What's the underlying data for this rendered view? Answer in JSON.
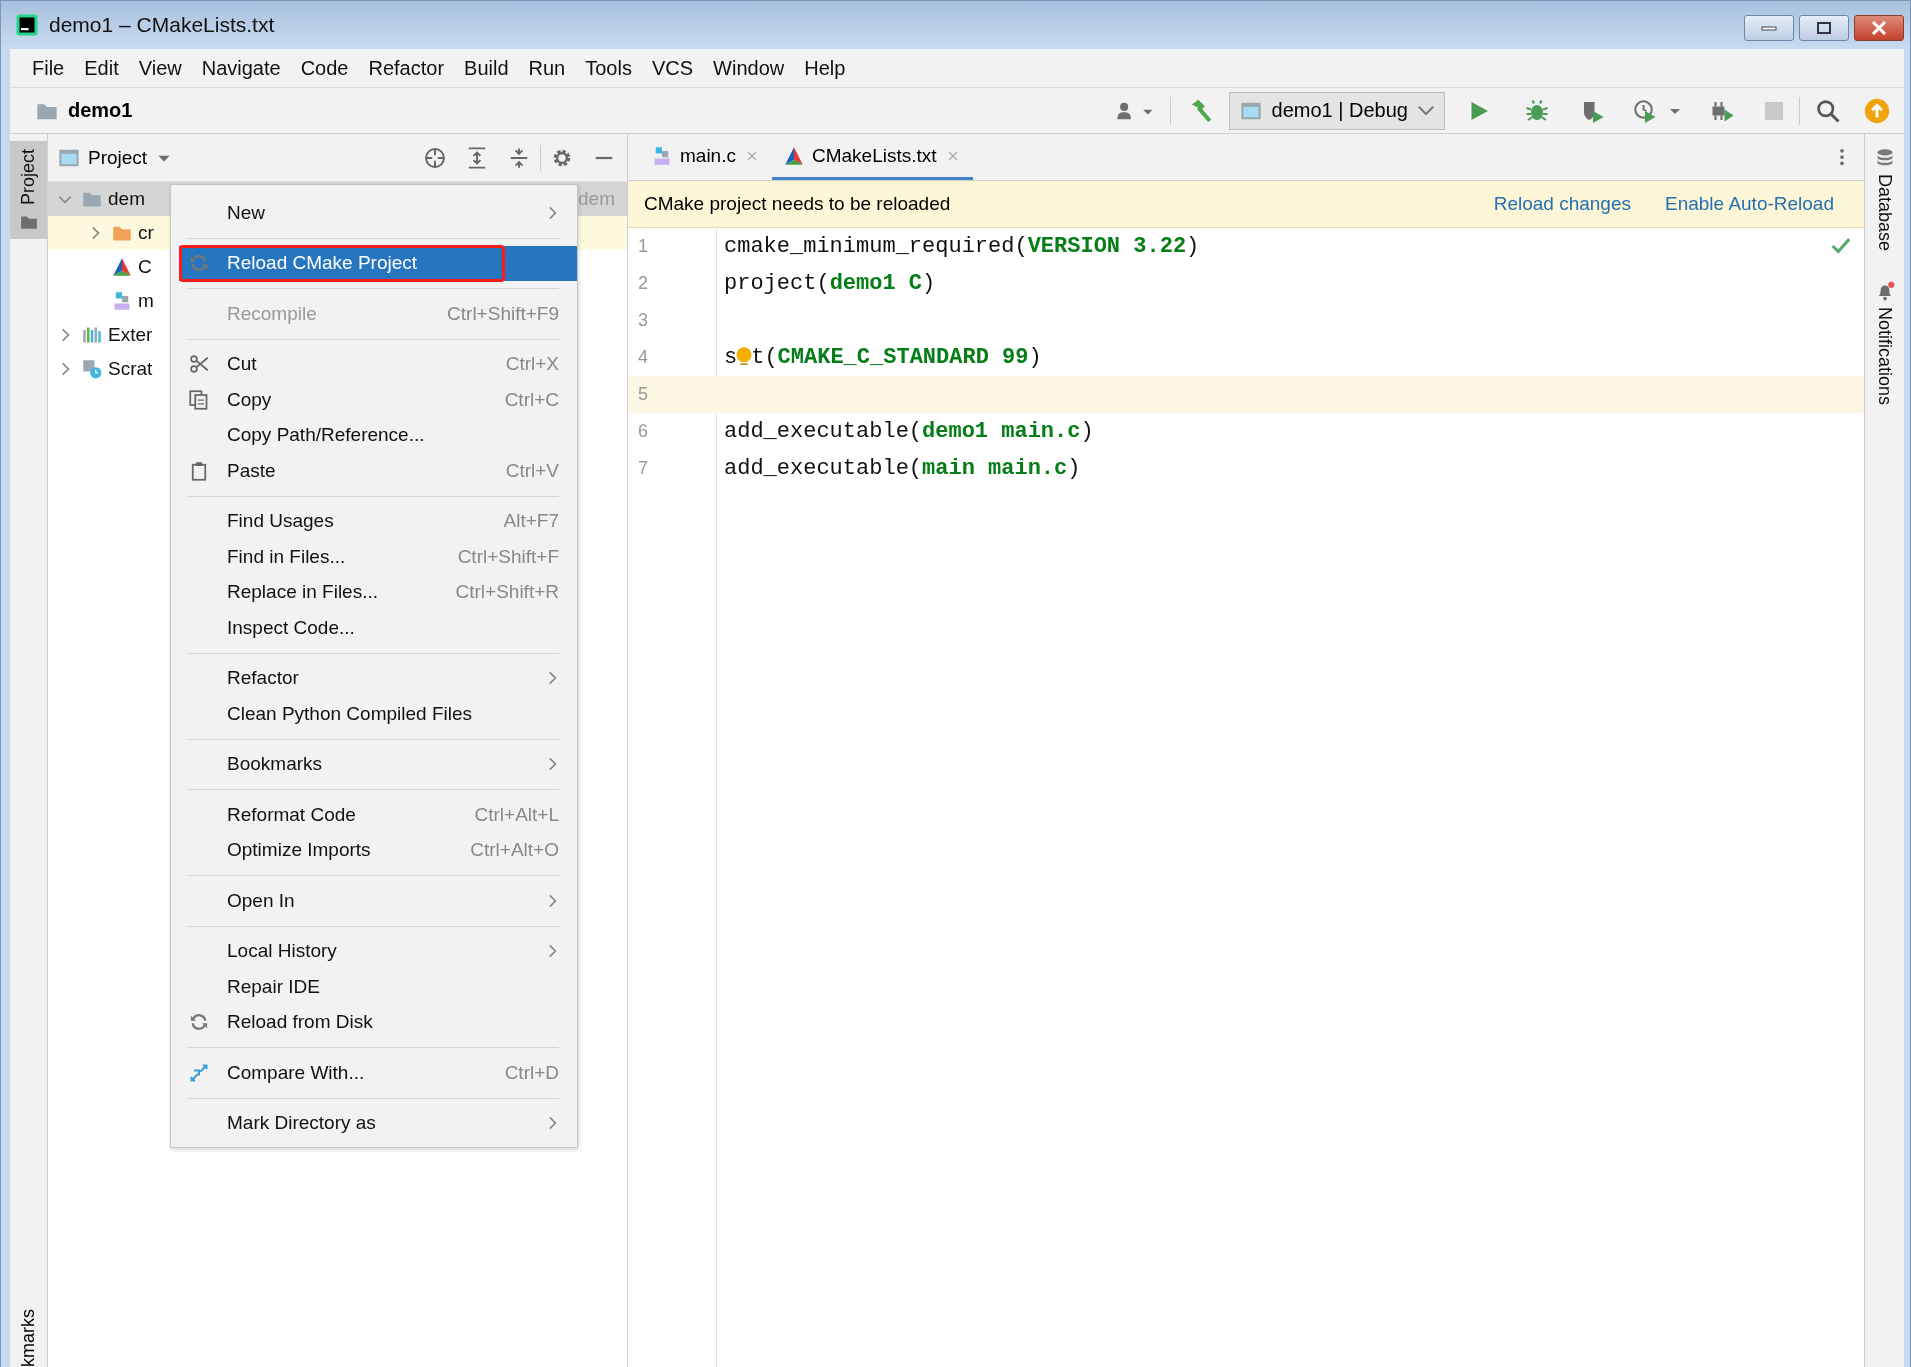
{
  "window": {
    "title": "demo1 – CMakeLists.txt"
  },
  "menu_bar": [
    "File",
    "Edit",
    "View",
    "Navigate",
    "Code",
    "Refactor",
    "Build",
    "Run",
    "Tools",
    "VCS",
    "Window",
    "Help"
  ],
  "navigation_bar": {
    "project": "demo1"
  },
  "toolbar": {
    "run_configuration": "demo1 | Debug",
    "stop": {
      "disabled": true
    }
  },
  "left_stripe": {
    "tabs": [
      {
        "label": "Project",
        "selected": true
      }
    ],
    "bottom_tab": "kmarks"
  },
  "project_panel": {
    "title": "Project",
    "tree": [
      {
        "label": "dem",
        "hint": "dem",
        "kind": "module",
        "selected": true,
        "highlighted": false,
        "expanded": true,
        "children": [
          {
            "label": "cr",
            "kind": "folder",
            "selected": false,
            "highlighted": true,
            "expanded": false
          },
          {
            "label": "C",
            "kind": "cmake",
            "selected": false,
            "highlighted": false
          },
          {
            "label": "m",
            "kind": "cfile",
            "selected": false,
            "highlighted": false
          }
        ]
      },
      {
        "label": "Exter",
        "kind": "library",
        "selected": false,
        "highlighted": false,
        "expanded": false
      },
      {
        "label": "Scrat",
        "kind": "scratch",
        "selected": false,
        "highlighted": false,
        "expanded": false
      }
    ]
  },
  "context_menu": {
    "groups": [
      [
        {
          "label": "New",
          "kind": "plain",
          "submenu": true,
          "disabled": false,
          "selected": false
        }
      ],
      [
        {
          "label": "Reload CMake Project",
          "kind": "reload",
          "submenu": false,
          "disabled": false,
          "selected": true,
          "outlined": true
        }
      ],
      [
        {
          "label": "Recompile",
          "kind": "plain",
          "shortcut": "Ctrl+Shift+F9",
          "submenu": false,
          "disabled": true,
          "selected": false
        }
      ],
      [
        {
          "label": "Cut",
          "kind": "cut",
          "shortcut": "Ctrl+X",
          "submenu": false,
          "disabled": false,
          "selected": false
        },
        {
          "label": "Copy",
          "kind": "copy",
          "shortcut": "Ctrl+C",
          "submenu": false,
          "disabled": false,
          "selected": false
        },
        {
          "label": "Copy Path/Reference...",
          "kind": "plain",
          "submenu": false,
          "disabled": false,
          "selected": false
        },
        {
          "label": "Paste",
          "kind": "paste",
          "shortcut": "Ctrl+V",
          "submenu": false,
          "disabled": false,
          "selected": false
        }
      ],
      [
        {
          "label": "Find Usages",
          "kind": "plain",
          "shortcut": "Alt+F7",
          "submenu": false,
          "disabled": false,
          "selected": false
        },
        {
          "label": "Find in Files...",
          "kind": "plain",
          "shortcut": "Ctrl+Shift+F",
          "submenu": false,
          "disabled": false,
          "selected": false
        },
        {
          "label": "Replace in Files...",
          "kind": "plain",
          "shortcut": "Ctrl+Shift+R",
          "submenu": false,
          "disabled": false,
          "selected": false
        },
        {
          "label": "Inspect Code...",
          "kind": "plain",
          "submenu": false,
          "disabled": false,
          "selected": false
        }
      ],
      [
        {
          "label": "Refactor",
          "kind": "plain",
          "submenu": true,
          "disabled": false,
          "selected": false
        },
        {
          "label": "Clean Python Compiled Files",
          "kind": "plain",
          "submenu": false,
          "disabled": false,
          "selected": false
        }
      ],
      [
        {
          "label": "Bookmarks",
          "kind": "plain",
          "submenu": true,
          "disabled": false,
          "selected": false
        }
      ],
      [
        {
          "label": "Reformat Code",
          "kind": "plain",
          "shortcut": "Ctrl+Alt+L",
          "submenu": false,
          "disabled": false,
          "selected": false
        },
        {
          "label": "Optimize Imports",
          "kind": "plain",
          "shortcut": "Ctrl+Alt+O",
          "submenu": false,
          "disabled": false,
          "selected": false
        }
      ],
      [
        {
          "label": "Open In",
          "kind": "plain",
          "submenu": true,
          "disabled": false,
          "selected": false
        }
      ],
      [
        {
          "label": "Local History",
          "kind": "plain",
          "submenu": true,
          "disabled": false,
          "selected": false
        },
        {
          "label": "Repair IDE",
          "kind": "plain",
          "submenu": false,
          "disabled": false,
          "selected": false
        },
        {
          "label": "Reload from Disk",
          "kind": "reload",
          "submenu": false,
          "disabled": false,
          "selected": false
        }
      ],
      [
        {
          "label": "Compare With...",
          "kind": "compare",
          "shortcut": "Ctrl+D",
          "submenu": false,
          "disabled": false,
          "selected": false
        }
      ],
      [
        {
          "label": "Mark Directory as",
          "kind": "plain",
          "submenu": true,
          "disabled": false,
          "selected": false
        }
      ]
    ]
  },
  "editor": {
    "tabs": [
      {
        "label": "main.c",
        "kind": "cfile",
        "selected": false
      },
      {
        "label": "CMakeLists.txt",
        "kind": "cmake",
        "selected": true
      }
    ],
    "banner": {
      "message": "CMake project needs to be reloaded",
      "actions": [
        "Reload changes",
        "Enable Auto-Reload"
      ]
    },
    "lines": [
      {
        "number": "1",
        "current": false,
        "tokens": [
          {
            "kind": "plain",
            "text": "cmake_minimum_required("
          },
          {
            "kind": "arg",
            "text": "VERSION 3.22"
          },
          {
            "kind": "plain",
            "text": ")"
          }
        ]
      },
      {
        "number": "2",
        "current": false,
        "tokens": [
          {
            "kind": "plain",
            "text": "project("
          },
          {
            "kind": "arg",
            "text": "demo1 C"
          },
          {
            "kind": "plain",
            "text": ")"
          }
        ]
      },
      {
        "number": "3",
        "current": false
      },
      {
        "number": "4",
        "current": false,
        "tokens": [
          {
            "kind": "plain",
            "text": "s"
          },
          {
            "kind": "bulb"
          },
          {
            "kind": "plain",
            "text": "t("
          },
          {
            "kind": "arg",
            "text": "CMAKE_C_STANDARD 99"
          },
          {
            "kind": "plain",
            "text": ")"
          }
        ]
      },
      {
        "number": "5",
        "current": true
      },
      {
        "number": "6",
        "current": false,
        "tokens": [
          {
            "kind": "plain",
            "text": "add_executable("
          },
          {
            "kind": "arg",
            "text": "demo1 main.c"
          },
          {
            "kind": "plain",
            "text": ")"
          }
        ]
      },
      {
        "number": "7",
        "current": false,
        "tokens": [
          {
            "kind": "plain",
            "text": "add_executable("
          },
          {
            "kind": "arg",
            "text": "main main.c"
          },
          {
            "kind": "plain",
            "text": ")"
          }
        ]
      }
    ]
  },
  "right_stripe": {
    "tabs": [
      {
        "label": "Database",
        "kind": "database"
      },
      {
        "label": "Notifications",
        "kind": "bell"
      }
    ]
  }
}
